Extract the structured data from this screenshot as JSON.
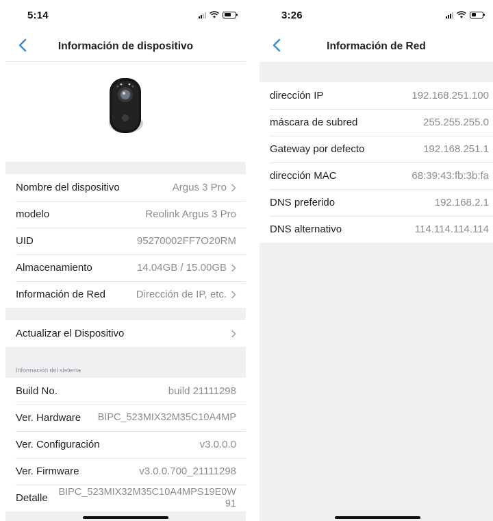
{
  "left_screen": {
    "status_time": "5:14",
    "title": "Información de dispositivo",
    "device_rows": [
      {
        "label": "Nombre del dispositivo",
        "value": "Argus 3 Pro",
        "chevron": true
      },
      {
        "label": "modelo",
        "value": "Reolink Argus 3 Pro",
        "chevron": false
      },
      {
        "label": "UID",
        "value": "95270002FF7O20RM",
        "chevron": false
      },
      {
        "label": "Almacenamiento",
        "value": "14.04GB / 15.00GB",
        "chevron": true
      },
      {
        "label": "Información de Red",
        "value": "Dirección de IP, etc.",
        "chevron": true
      }
    ],
    "update_row": {
      "label": "Actualizar el Dispositivo"
    },
    "system_section_header": "Información del sistema",
    "system_rows": [
      {
        "label": "Build No.",
        "value": "build 21111298"
      },
      {
        "label": "Ver. Hardware",
        "value": "BIPC_523MIX32M35C10A4MP"
      },
      {
        "label": "Ver. Configuración",
        "value": "v3.0.0.0"
      },
      {
        "label": "Ver. Firmware",
        "value": "v3.0.0.700_21111298"
      },
      {
        "label": "Detalle",
        "value": "BIPC_523MIX32M35C10A4MPS19E0W91"
      }
    ]
  },
  "right_screen": {
    "status_time": "3:26",
    "title": "Información de Red",
    "rows": [
      {
        "label": "dirección IP",
        "value": "192.168.251.100"
      },
      {
        "label": "máscara de subred",
        "value": "255.255.255.0"
      },
      {
        "label": "Gateway por defecto",
        "value": "192.168.251.1"
      },
      {
        "label": "dirección MAC",
        "value": "68:39:43:fb:3b:fa"
      },
      {
        "label": "DNS preferido",
        "value": "192.168.2.1"
      },
      {
        "label": "DNS alternativo",
        "value": "114.114.114.114"
      }
    ]
  },
  "icons": [
    "back-chevron-icon",
    "chevron-right-icon",
    "signal-icon",
    "wifi-icon",
    "battery-icon",
    "camera-image"
  ],
  "colors": {
    "accent": "#3a8fd6",
    "background": "#f0f0f3",
    "value_text": "#8c8c8c"
  }
}
